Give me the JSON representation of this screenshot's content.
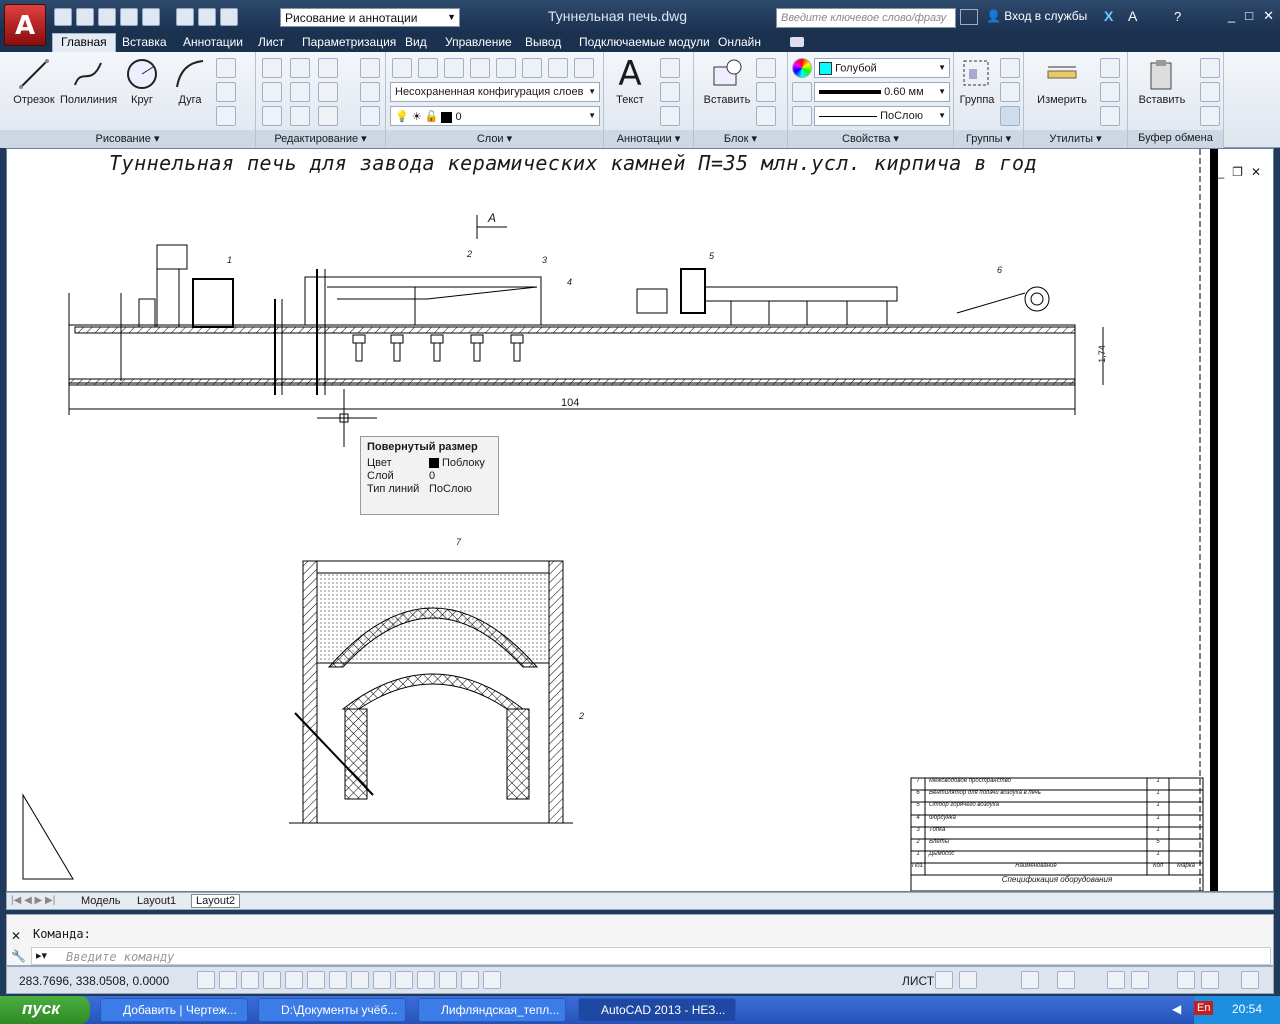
{
  "title_bar": {
    "workspace": "Рисование и аннотации",
    "document_title": "Туннельная печь.dwg",
    "search_placeholder": "Введите ключевое слово/фразу",
    "signin_label": "Вход в службы"
  },
  "ribbon_tabs": [
    "Главная",
    "Вставка",
    "Аннотации",
    "Лист",
    "Параметризация",
    "Вид",
    "Управление",
    "Вывод",
    "Подключаемые модули",
    "Онлайн"
  ],
  "panels": {
    "draw": {
      "title": "Рисование",
      "line": "Отрезок",
      "polyline": "Полилиния",
      "circle": "Круг",
      "arc": "Дуга"
    },
    "modify": {
      "title": "Редактирование"
    },
    "layers": {
      "title": "Слои",
      "config": "Несохраненная конфигурация слоев",
      "layer_value": "0"
    },
    "annotations": {
      "title": "Аннотации",
      "text": "Текст"
    },
    "block": {
      "title": "Блок",
      "insert": "Вставить"
    },
    "properties": {
      "title": "Свойства",
      "color": "Голубой",
      "lineweight": "0.60 мм",
      "linetype": "ПоСлою"
    },
    "groups": {
      "title": "Группы",
      "group": "Группа"
    },
    "utilities": {
      "title": "Утилиты",
      "measure": "Измерить"
    },
    "clipboard": {
      "title": "Буфер обмена",
      "paste": "Вставить"
    }
  },
  "drawing": {
    "heading": "Туннельная печь для завода керамических камней П=35 млн.усл. кирпича в год",
    "section_mark": "А",
    "dim_length": "104",
    "dim_height": "1,74",
    "callouts": [
      "1",
      "2",
      "3",
      "4",
      "5",
      "6",
      "7",
      "2"
    ]
  },
  "tooltip": {
    "title": "Повернутый размер",
    "rows": [
      {
        "label": "Цвет",
        "value": "Поблоку"
      },
      {
        "label": "Слой",
        "value": "0"
      },
      {
        "label": "Тип линий",
        "value": "ПоСлою"
      }
    ]
  },
  "spec_table": {
    "rows": [
      {
        "pos": "7",
        "name": "Межсводовое пространство",
        "qty": "1"
      },
      {
        "pos": "6",
        "name": "Вентилятор для подачи воздуха в печь",
        "qty": "1"
      },
      {
        "pos": "5",
        "name": "Отбор горячего воздуха",
        "qty": "1"
      },
      {
        "pos": "4",
        "name": "Форсунка",
        "qty": "1"
      },
      {
        "pos": "3",
        "name": "Топка",
        "qty": "1"
      },
      {
        "pos": "2",
        "name": "Влеты",
        "qty": "5"
      },
      {
        "pos": "1",
        "name": "Дымосос",
        "qty": "1"
      }
    ],
    "header": {
      "pos": "Поз.",
      "name": "Наименование",
      "qty": "Кол",
      "mark": "Марка"
    },
    "caption": "Спецификация оборудования"
  },
  "layout_tabs": [
    "Модель",
    "Layout1",
    "Layout2"
  ],
  "command": {
    "label": "Команда:",
    "placeholder": "Введите команду"
  },
  "status": {
    "coords": "283.7696, 338.0508, 0.0000",
    "space": "ЛИСТ"
  },
  "taskbar": {
    "start": "пуск",
    "tasks": [
      "Добавить | Чертеж...",
      "D:\\Документы учёб...",
      "Лифляндская_тепл...",
      "AutoCAD 2013 - НЕЗ..."
    ],
    "lang": "En",
    "time": "20:54"
  }
}
